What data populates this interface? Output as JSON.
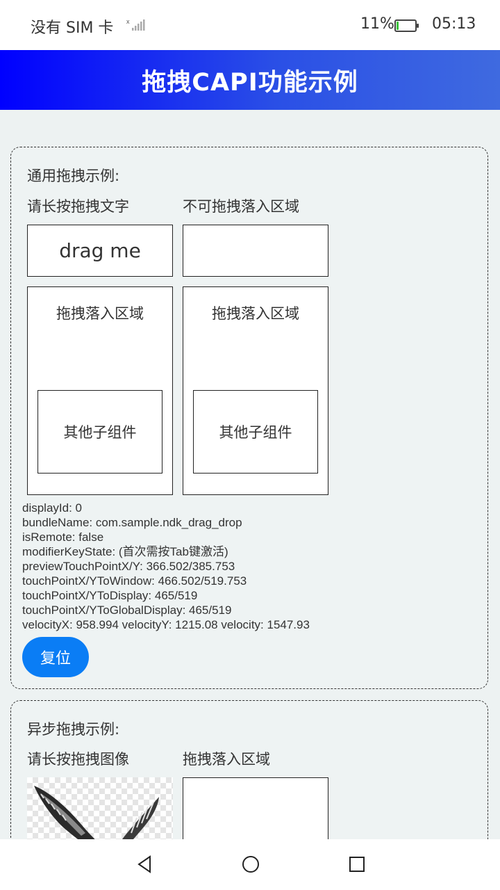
{
  "status_bar": {
    "carrier": "没有 SIM 卡",
    "battery_percent": "11%",
    "battery_level": 0.11,
    "time": "05:13"
  },
  "header": {
    "title": "拖拽CAPI功能示例"
  },
  "card_general": {
    "heading": "通用拖拽示例:",
    "drag_label": "请长按拖拽文字",
    "no_drop_label": "不可拖拽落入区域",
    "drag_text": "drag me",
    "drop_zone_left": "拖拽落入区域",
    "drop_zone_right": "拖拽落入区域",
    "child_left": "其他子组件",
    "child_right": "其他子组件",
    "info_lines": [
      "displayId: 0",
      "bundleName: com.sample.ndk_drag_drop",
      "isRemote: false",
      "modifierKeyState: (首次需按Tab键激活)",
      "previewTouchPointX/Y: 366.502/385.753",
      "touchPointX/YToWindow: 466.502/519.753",
      "touchPointX/YToDisplay: 465/519",
      "touchPointX/YToGlobalDisplay: 465/519",
      "velocityX: 958.994  velocityY: 1215.08  velocity: 1547.93"
    ],
    "reset_button": "复位"
  },
  "card_async": {
    "heading": "异步拖拽示例:",
    "drag_image_label": "请长按拖拽图像",
    "drop_label": "拖拽落入区域"
  },
  "nav": {
    "back_icon": "back-triangle-icon",
    "home_icon": "home-circle-icon",
    "recents_icon": "recents-square-icon"
  },
  "colors": {
    "title_gradient_start": "#0000ff",
    "title_gradient_end": "#3f6ae0",
    "button_blue": "#0a7df5",
    "page_background": "#edf2f2"
  }
}
